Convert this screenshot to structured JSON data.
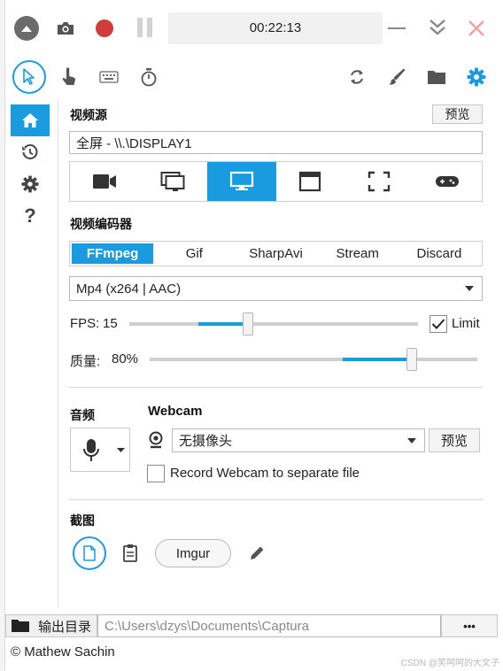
{
  "titlebar": {
    "timer": "00:22:13",
    "icons": [
      "collapse-up-icon",
      "camera-icon",
      "record-icon",
      "pause-icon",
      "minimize-icon",
      "chevron-double-down-icon",
      "close-icon"
    ]
  },
  "toolbar": {
    "icons": [
      "cursor-icon",
      "hand-click-icon",
      "keyboard-icon",
      "stopwatch-icon",
      "refresh-icon",
      "brush-icon",
      "folder-icon",
      "settings-icon"
    ]
  },
  "sidebar": {
    "items": [
      "home-icon",
      "history-icon",
      "settings-icon",
      "help-icon"
    ]
  },
  "video_source": {
    "title": "视频源",
    "preview_label": "预览",
    "current": "全屏 - \\\\.\\DISPLAY1",
    "source_buttons": [
      "camera-icon",
      "windows-icon",
      "screen-icon",
      "window-icon",
      "region-icon",
      "gamepad-icon"
    ],
    "active_index": 2
  },
  "encoder": {
    "title": "视频编码器",
    "options": [
      "FFmpeg",
      "Gif",
      "SharpAvi",
      "Stream",
      "Discard"
    ],
    "active_index": 0,
    "format": "Mp4 (x264 | AAC)",
    "fps_label": "FPS:",
    "fps_value": "15",
    "fps_fraction": 0.41,
    "limit_label": "Limit",
    "limit_checked": true,
    "quality_label": "质量:",
    "quality_value": "80%",
    "quality_fraction": 0.8
  },
  "audio": {
    "title": "音频"
  },
  "webcam": {
    "title": "Webcam",
    "device": "无摄像头",
    "preview_label": "预览",
    "separate_label": "Record Webcam to separate file",
    "separate_checked": false
  },
  "screenshot": {
    "title": "截图",
    "imgur_label": "Imgur"
  },
  "footer": {
    "output_label": "输出目录",
    "output_path": "C:\\Users\\dzys\\Documents\\Captura",
    "more_label": "•••",
    "credit": "© Mathew Sachin",
    "watermark": "CSDN @笑呵呵的大文子"
  },
  "colors": {
    "accent": "#1a9be0",
    "record": "#d03b3b",
    "close": "#f0a0a0"
  }
}
